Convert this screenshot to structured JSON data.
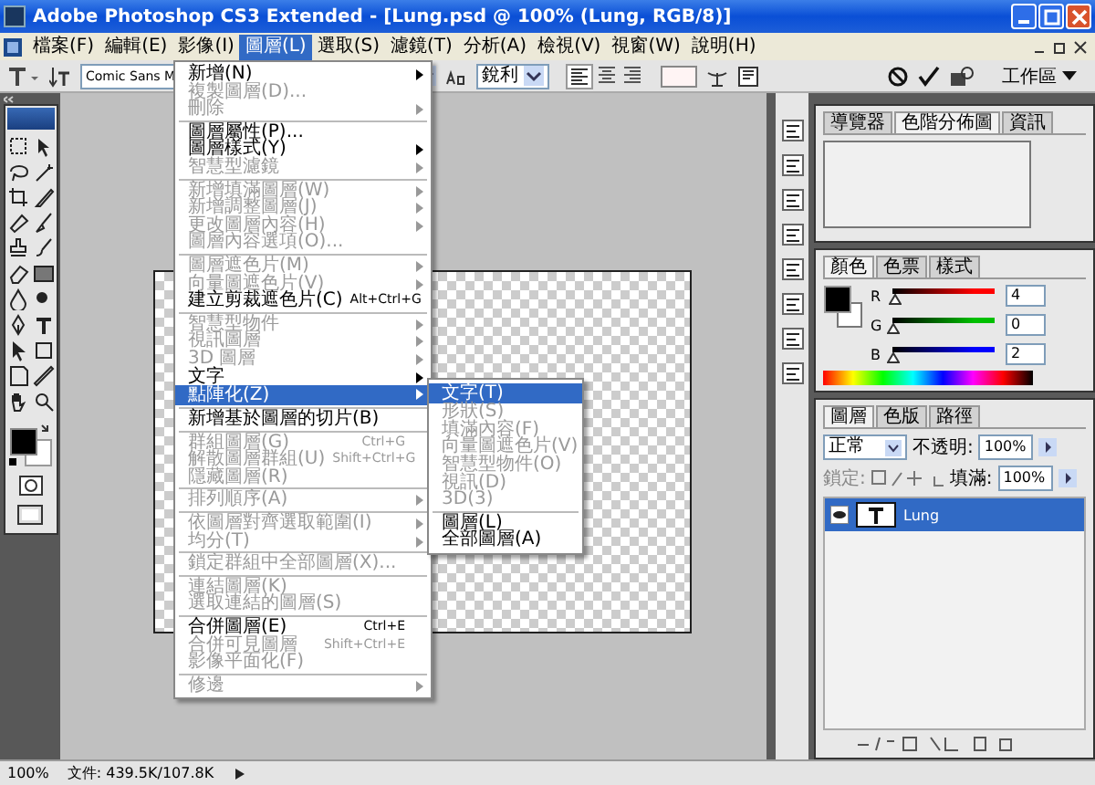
{
  "window": {
    "title": "Adobe Photoshop CS3 Extended - [Lung.psd @ 100% (Lung, RGB/8)]"
  },
  "menu_bar": [
    {
      "label": "檔案(F)",
      "selected": false
    },
    {
      "label": "編輯(E)",
      "selected": false
    },
    {
      "label": "影像(I)",
      "selected": false
    },
    {
      "label": "圖層(L)",
      "selected": true
    },
    {
      "label": "選取(S)",
      "selected": false
    },
    {
      "label": "濾鏡(T)",
      "selected": false
    },
    {
      "label": "分析(A)",
      "selected": false
    },
    {
      "label": "檢視(V)",
      "selected": false
    },
    {
      "label": "視窗(W)",
      "selected": false
    },
    {
      "label": "說明(H)",
      "selected": false
    }
  ],
  "options_bar": {
    "font_family": "Comic Sans M",
    "antialias": "銳利",
    "workspace": "工作區"
  },
  "open_menu": {
    "items": [
      {
        "kind": "item",
        "label": "新增(N)",
        "submenu": true,
        "disabled": false,
        "selected": false
      },
      {
        "kind": "item",
        "label": "複製圖層(D)...",
        "disabled": true,
        "selected": false
      },
      {
        "kind": "item",
        "label": "刪除",
        "submenu": true,
        "disabled": true,
        "selected": false
      },
      {
        "kind": "separator"
      },
      {
        "kind": "item",
        "label": "圖層屬性(P)...",
        "disabled": false,
        "selected": false
      },
      {
        "kind": "item",
        "label": "圖層樣式(Y)",
        "submenu": true,
        "disabled": false,
        "selected": false
      },
      {
        "kind": "item",
        "label": "智慧型濾鏡",
        "submenu": true,
        "disabled": true,
        "selected": false
      },
      {
        "kind": "separator"
      },
      {
        "kind": "item",
        "label": "新增填滿圖層(W)",
        "submenu": true,
        "disabled": true,
        "selected": false
      },
      {
        "kind": "item",
        "label": "新增調整圖層(J)",
        "submenu": true,
        "disabled": true,
        "selected": false
      },
      {
        "kind": "item",
        "label": "更改圖層內容(H)",
        "submenu": true,
        "disabled": true,
        "selected": false
      },
      {
        "kind": "item",
        "label": "圖層內容選項(O)...",
        "disabled": true,
        "selected": false
      },
      {
        "kind": "separator"
      },
      {
        "kind": "item",
        "label": "圖層遮色片(M)",
        "submenu": true,
        "disabled": true,
        "selected": false
      },
      {
        "kind": "item",
        "label": "向量圖遮色片(V)",
        "submenu": true,
        "disabled": true,
        "selected": false
      },
      {
        "kind": "item",
        "label": "建立剪裁遮色片(C)",
        "shortcut": "Alt+Ctrl+G",
        "disabled": false,
        "selected": false
      },
      {
        "kind": "separator"
      },
      {
        "kind": "item",
        "label": "智慧型物件",
        "submenu": true,
        "disabled": true,
        "selected": false
      },
      {
        "kind": "item",
        "label": "視訊圖層",
        "submenu": true,
        "disabled": true,
        "selected": false
      },
      {
        "kind": "item",
        "label": "3D 圖層",
        "submenu": true,
        "disabled": true,
        "selected": false
      },
      {
        "kind": "item",
        "label": "文字",
        "submenu": true,
        "disabled": false,
        "selected": false
      },
      {
        "kind": "item",
        "label": "點陣化(Z)",
        "submenu": true,
        "disabled": false,
        "selected": true
      },
      {
        "kind": "separator"
      },
      {
        "kind": "item",
        "label": "新增基於圖層的切片(B)",
        "disabled": false,
        "selected": false
      },
      {
        "kind": "separator"
      },
      {
        "kind": "item",
        "label": "群組圖層(G)",
        "shortcut": "Ctrl+G",
        "disabled": true,
        "selected": false
      },
      {
        "kind": "item",
        "label": "解散圖層群組(U)",
        "shortcut": "Shift+Ctrl+G",
        "disabled": true,
        "selected": false
      },
      {
        "kind": "item",
        "label": "隱藏圖層(R)",
        "disabled": true,
        "selected": false
      },
      {
        "kind": "separator"
      },
      {
        "kind": "item",
        "label": "排列順序(A)",
        "submenu": true,
        "disabled": true,
        "selected": false
      },
      {
        "kind": "separator"
      },
      {
        "kind": "item",
        "label": "依圖層對齊選取範圍(I)",
        "submenu": true,
        "disabled": true,
        "selected": false
      },
      {
        "kind": "item",
        "label": "均分(T)",
        "submenu": true,
        "disabled": true,
        "selected": false
      },
      {
        "kind": "separator"
      },
      {
        "kind": "item",
        "label": "鎖定群組中全部圖層(X)...",
        "disabled": true,
        "selected": false
      },
      {
        "kind": "separator"
      },
      {
        "kind": "item",
        "label": "連結圖層(K)",
        "disabled": true,
        "selected": false
      },
      {
        "kind": "item",
        "label": "選取連結的圖層(S)",
        "disabled": true,
        "selected": false
      },
      {
        "kind": "separator"
      },
      {
        "kind": "item",
        "label": "合併圖層(E)",
        "shortcut": "Ctrl+E",
        "disabled": false,
        "selected": false
      },
      {
        "kind": "item",
        "label": "合併可見圖層",
        "shortcut": "Shift+Ctrl+E",
        "disabled": true,
        "selected": false
      },
      {
        "kind": "item",
        "label": "影像平面化(F)",
        "disabled": true,
        "selected": false
      },
      {
        "kind": "separator"
      },
      {
        "kind": "item",
        "label": "修邊",
        "submenu": true,
        "disabled": true,
        "selected": false
      }
    ]
  },
  "submenu": {
    "items": [
      {
        "kind": "item",
        "label": "文字(T)",
        "disabled": false,
        "selected": true
      },
      {
        "kind": "item",
        "label": "形狀(S)",
        "disabled": true,
        "selected": false
      },
      {
        "kind": "item",
        "label": "填滿內容(F)",
        "disabled": true,
        "selected": false
      },
      {
        "kind": "item",
        "label": "向量圖遮色片(V)",
        "disabled": true,
        "selected": false
      },
      {
        "kind": "item",
        "label": "智慧型物件(O)",
        "disabled": true,
        "selected": false
      },
      {
        "kind": "item",
        "label": "視訊(D)",
        "disabled": true,
        "selected": false
      },
      {
        "kind": "item",
        "label": "3D(3)",
        "disabled": true,
        "selected": false
      },
      {
        "kind": "separator"
      },
      {
        "kind": "item",
        "label": "圖層(L)",
        "disabled": false,
        "selected": false
      },
      {
        "kind": "item",
        "label": "全部圖層(A)",
        "disabled": false,
        "selected": false
      }
    ]
  },
  "histogram_panel": {
    "tabs": [
      {
        "label": "導覽器",
        "selected": false
      },
      {
        "label": "色階分佈圖",
        "selected": true
      },
      {
        "label": "資訊",
        "selected": false
      }
    ]
  },
  "color_panel": {
    "tabs": [
      {
        "label": "顏色",
        "selected": true
      },
      {
        "label": "色票",
        "selected": false
      },
      {
        "label": "樣式",
        "selected": false
      }
    ],
    "channels": [
      {
        "name": "R",
        "color": "#ff0000",
        "level": 0.016,
        "value": "4"
      },
      {
        "name": "G",
        "color": "#00c000",
        "level": 0.0,
        "value": "0"
      },
      {
        "name": "B",
        "color": "#0000ff",
        "level": 0.008,
        "value": "2"
      }
    ]
  },
  "layers_panel": {
    "tabs": [
      {
        "label": "圖層",
        "selected": true
      },
      {
        "label": "色版",
        "selected": false
      },
      {
        "label": "路徑",
        "selected": false
      }
    ],
    "blend_mode": "正常",
    "opacity_label": "不透明:",
    "opacity": "100%",
    "lock_label": "鎖定:",
    "fill_label": "填滿:",
    "fill": "100%",
    "layers": [
      {
        "name": "Lung",
        "kind": "text",
        "selected": true,
        "visible": true
      }
    ]
  },
  "status_bar": {
    "zoom": "100%",
    "document": "文件: 439.5K/107.8K"
  }
}
